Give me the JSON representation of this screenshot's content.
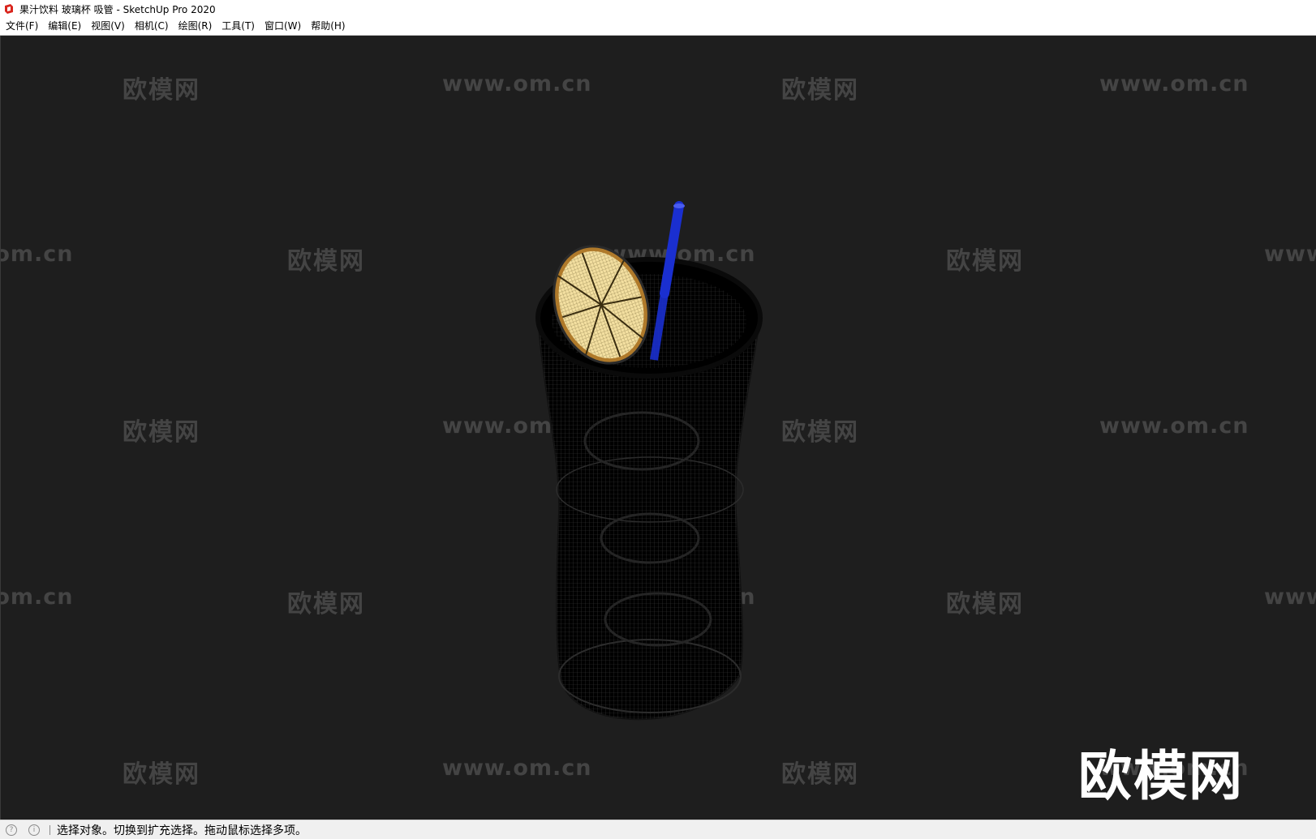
{
  "window": {
    "title": "果汁饮料 玻璃杯 吸管 - SketchUp Pro 2020",
    "icon": "sketchup-icon"
  },
  "menu": {
    "items": [
      {
        "label": "文件(F)"
      },
      {
        "label": "编辑(E)"
      },
      {
        "label": "视图(V)"
      },
      {
        "label": "相机(C)"
      },
      {
        "label": "绘图(R)"
      },
      {
        "label": "工具(T)"
      },
      {
        "label": "窗口(W)"
      },
      {
        "label": "帮助(H)"
      }
    ]
  },
  "viewport": {
    "background": "#1e1e1e",
    "watermark_cn": "欧模网",
    "watermark_url": "www.om.cn",
    "brand_logo": "欧模网",
    "model": {
      "glass_color": "#000000",
      "straw_color": "#1a2fd0",
      "lemon_color": "#f3dfa0"
    }
  },
  "statusbar": {
    "message": "选择对象。切换到扩充选择。拖动鼠标选择多项。",
    "icons": [
      "geo-location-icon",
      "info-icon"
    ]
  }
}
